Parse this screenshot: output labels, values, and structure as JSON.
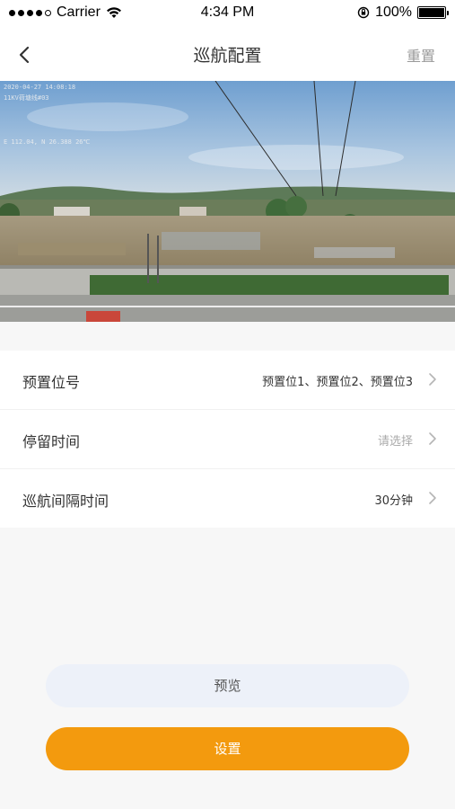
{
  "status_bar": {
    "carrier": "Carrier",
    "time": "4:34 PM",
    "battery": "100%"
  },
  "nav": {
    "title": "巡航配置",
    "reset_label": "重置",
    "back_icon": "chevron-left-icon"
  },
  "video": {
    "osd_line1": "2020-04-27 14:08:18",
    "osd_line2": "11KV荷塘线#03",
    "osd_line3": "E 112.04, N 26.388 26℃"
  },
  "settings": [
    {
      "label": "预置位号",
      "value": "预置位1、预置位2、预置位3",
      "placeholder": false
    },
    {
      "label": "停留时间",
      "value": "请选择",
      "placeholder": true
    },
    {
      "label": "巡航间隔时间",
      "value": "30分钟",
      "placeholder": false
    }
  ],
  "buttons": {
    "preview": "预览",
    "set": "设置"
  },
  "colors": {
    "accent": "#f39a0e",
    "preview_bg": "#edf1f9",
    "background": "#f7f7f7"
  }
}
